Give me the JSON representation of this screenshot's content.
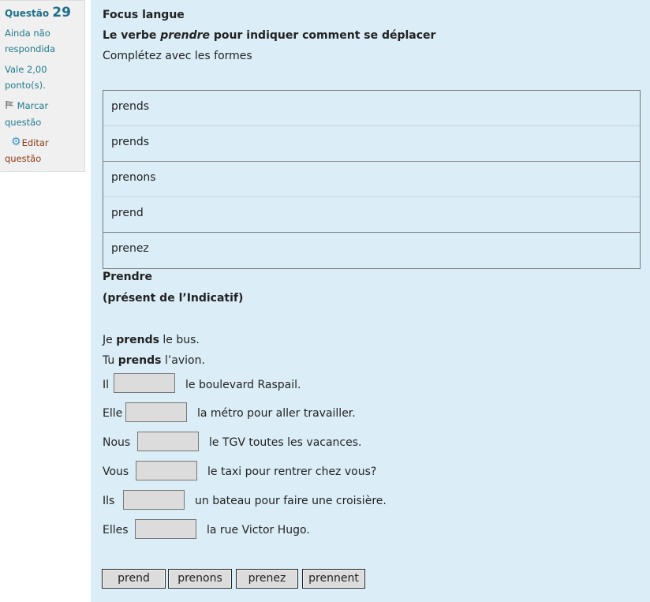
{
  "info": {
    "question_label": "Questão",
    "question_number": "29",
    "state": [
      "Ainda não",
      "respondida"
    ],
    "grade": [
      "Vale 2,00",
      "ponto(s)."
    ],
    "flag": [
      "Marcar",
      "questão"
    ],
    "edit": [
      "Editar",
      "questão"
    ],
    "icons": {
      "flag": "flag-icon",
      "edit": "gear-icon"
    }
  },
  "question": {
    "title": "Focus langue",
    "subtitle_pre": "Le verbe ",
    "subtitle_em": "prendre",
    "subtitle_post": " pour indiquer comment se déplacer",
    "instruction": "Complétez avec les formes"
  },
  "forms": [
    "prends",
    "prends",
    "prenons",
    "prend",
    "prenez"
  ],
  "conjugation": {
    "verb": "Prendre",
    "tense": "(présent de l’Indicatif)",
    "examples": [
      {
        "subject": "Je ",
        "verb": "prends",
        "rest": " le bus."
      },
      {
        "subject": "Tu ",
        "verb": "prends",
        "rest": " l’avion."
      }
    ],
    "blanks": [
      {
        "subject": "Il",
        "rest": "le boulevard Raspail."
      },
      {
        "subject": "Elle",
        "rest": "la métro pour aller travailler."
      },
      {
        "subject": "Nous",
        "rest": "le TGV toutes les vacances."
      },
      {
        "subject": "Vous",
        "rest": "le taxi pour rentrer chez vous?"
      },
      {
        "subject": "Ils",
        "rest": "un bateau pour faire une croisière."
      },
      {
        "subject": "Elles",
        "rest": "la rue Victor Hugo."
      }
    ]
  },
  "choices": [
    "prend",
    "prenons",
    "prenez",
    "prennent"
  ],
  "colors": {
    "content_bg": "#dbedf6",
    "info_bg": "#f0f0f0",
    "link": "#1f7a8c",
    "edit_link": "#8a3b12",
    "drop_bg": "#dcdcdc"
  }
}
